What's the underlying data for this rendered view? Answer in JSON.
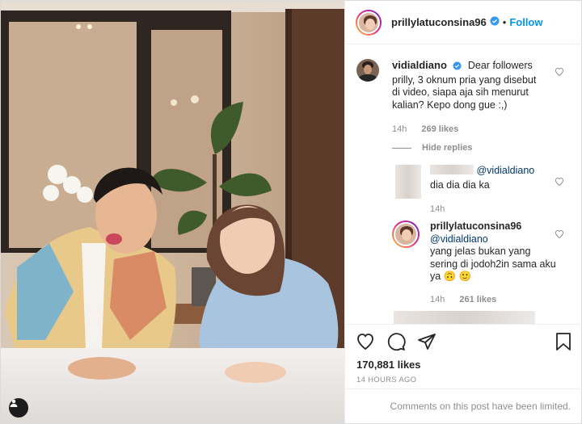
{
  "post": {
    "author": "prillylatuconsina96",
    "follow_label": "Follow",
    "separator": "•",
    "likes": "170,881 likes",
    "time_ago": "14 HOURS AGO",
    "comments_limited": "Comments on this post have been limited."
  },
  "comments": [
    {
      "username": "vidialdiano",
      "verified": true,
      "text": "Dear followers prilly, 3 oknum pria yang disebut di video, siapa aja sih menurut kalian? Kepo dong gue :,)",
      "time": "14h",
      "likes": "269 likes"
    }
  ],
  "hide_replies_label": "Hide replies",
  "replies": [
    {
      "mention": "@vidialdiano",
      "text": "dia dia dia ka",
      "time": "14h"
    },
    {
      "username": "prillylatuconsina96",
      "mention": "@vidialdiano",
      "text": "yang jelas bukan yang sering di jodoh2in sama aku ya 🙃 🙂",
      "time": "14h",
      "likes": "261 likes"
    }
  ],
  "icons": {
    "like": "heart-icon",
    "comment": "comment-icon",
    "share": "share-icon",
    "save": "bookmark-icon",
    "verified": "verified-badge-icon",
    "tagged": "user-tag-icon"
  },
  "colors": {
    "follow": "#0095f6",
    "verified": "#3897f0",
    "meta": "#8e8e8e",
    "mention": "#00376b"
  }
}
